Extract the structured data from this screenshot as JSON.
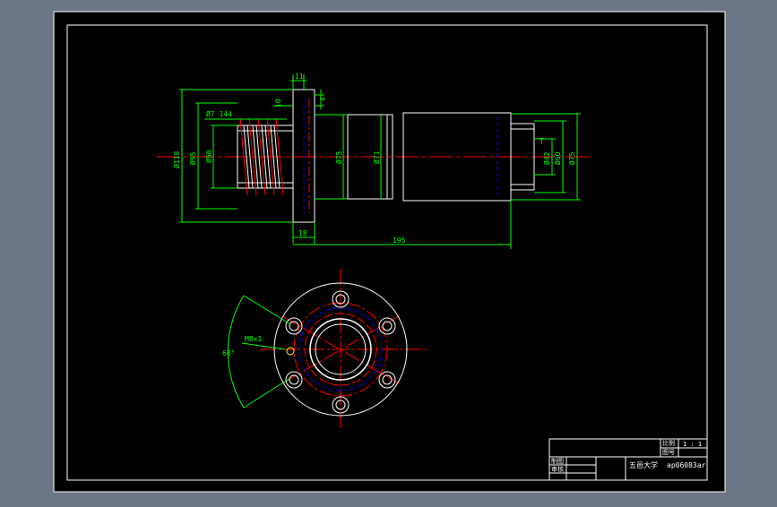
{
  "drawing": {
    "side_view_dims": {
      "d_flange_thickness": "11",
      "d_flange_offset": "10",
      "d_small_height": "4",
      "d_thread": "Ø7  144",
      "d_flange_dia": "Ø118",
      "d_bore_left": "Ø95",
      "d_body_left": "Ø50",
      "d_mid_75": "Ø75",
      "d_mid_71": "Ø71",
      "d_right_42": "Ø42",
      "d_right_60": "Ø60",
      "d_right_75": "Ø75",
      "d_T": "T",
      "d_bottom_18": "18",
      "d_bottom_195": "195"
    },
    "front_view": {
      "thread_note": "M8x1",
      "angle_note": "60°"
    },
    "title_block": {
      "scale_label": "比例",
      "scale_value": "1 : 1",
      "drawing_no_label": "图号",
      "drawn_by_label": "制图",
      "checked_by_label": "审核",
      "university": "五邑大学",
      "student_id": "ap06083ar"
    }
  },
  "colors": {
    "background": "#000000",
    "frame": "#ffffff",
    "dimension": "#00ff00",
    "centerline": "#ff0000",
    "hidden": "#0000ff",
    "outline": "#ffffff"
  }
}
